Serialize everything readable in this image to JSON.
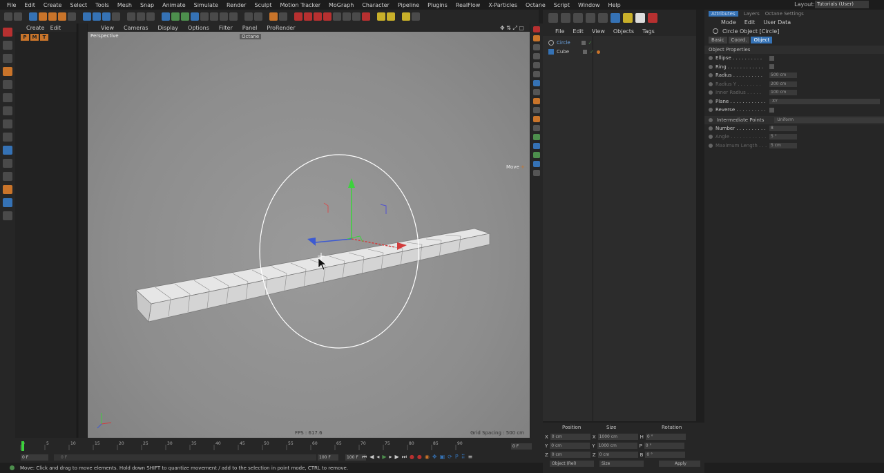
{
  "menubar": {
    "items": [
      "File",
      "Edit",
      "Create",
      "Select",
      "Tools",
      "Mesh",
      "Snap",
      "Animate",
      "Simulate",
      "Render",
      "Sculpt",
      "Motion Tracker",
      "MoGraph",
      "Character",
      "Pipeline",
      "Plugins",
      "RealFlow",
      "X-Particles",
      "Octane",
      "Script",
      "Window",
      "Help"
    ],
    "layout_label": "Layout:",
    "layout_value": "Tutorials (User)"
  },
  "content_browser": {
    "menu": [
      "Create",
      "Edit"
    ],
    "icons": [
      "P",
      "M",
      "T"
    ]
  },
  "viewport": {
    "menu": [
      "View",
      "Cameras",
      "Display",
      "Options",
      "Filter",
      "Panel",
      "ProRender"
    ],
    "name": "Perspective",
    "octane_chip": "Octane",
    "move_label": "Move",
    "fps": "FPS : 617.6",
    "grid_spacing": "Grid Spacing : 500 cm"
  },
  "object_manager": {
    "menu": [
      "File",
      "Edit",
      "View",
      "Objects",
      "Tags"
    ],
    "objects": [
      {
        "name": "Circle",
        "selected": true
      },
      {
        "name": "Cube",
        "selected": false
      }
    ]
  },
  "attributes": {
    "tabs": [
      "Attributes",
      "Layers",
      "Octane Settings"
    ],
    "menu": [
      "Mode",
      "Edit",
      "User Data"
    ],
    "title": "Circle Object [Circle]",
    "buttons": [
      "Basic",
      "Coord.",
      "Object"
    ],
    "section": "Object Properties",
    "props": [
      {
        "label": "Ellipse . . . . . . . . . .",
        "kind": "checkbox",
        "dim": false
      },
      {
        "label": "Ring . . . . . . . . . . . .",
        "kind": "checkbox",
        "dim": false
      },
      {
        "label": "Radius . . . . . . . . . .",
        "kind": "field",
        "value": "500 cm",
        "dim": false
      },
      {
        "label": "Radius Y . . . . . . . .",
        "kind": "field",
        "value": "200 cm",
        "dim": true
      },
      {
        "label": "Inner Radius . . . . .",
        "kind": "field",
        "value": "100 cm",
        "dim": true
      },
      {
        "label": "Plane . . . . . . . . . . . .",
        "kind": "select",
        "value": "XY",
        "dim": false
      },
      {
        "label": "Reverse . . . . . . . . . .",
        "kind": "checkbox",
        "dim": false
      }
    ],
    "intermediate": {
      "label": "Intermediate Points",
      "value": "Uniform"
    },
    "props2": [
      {
        "label": "Number . . . . . . . . . .",
        "kind": "field",
        "value": "8",
        "dim": false
      },
      {
        "label": "Angle . . . . . . . . . . . .",
        "kind": "field",
        "value": "5 °",
        "dim": true
      },
      {
        "label": "Maximum Length . . .",
        "kind": "field",
        "value": "5 cm",
        "dim": true
      }
    ]
  },
  "coordinates": {
    "headers": [
      "Position",
      "Size",
      "Rotation"
    ],
    "rows": [
      {
        "axis": "X",
        "pos": "0 cm",
        "saxis": "X",
        "size": "1000 cm",
        "raxis": "H",
        "rot": "0 °"
      },
      {
        "axis": "Y",
        "pos": "0 cm",
        "saxis": "Y",
        "size": "1000 cm",
        "raxis": "P",
        "rot": "0 °"
      },
      {
        "axis": "Z",
        "pos": "0 cm",
        "saxis": "Z",
        "size": "0 cm",
        "raxis": "B",
        "rot": "0 °"
      }
    ],
    "mode": "Object (Rel)",
    "size_mode": "Size",
    "apply": "Apply"
  },
  "timeline": {
    "ticks": [
      "0",
      "5",
      "10",
      "15",
      "20",
      "25",
      "30",
      "35",
      "40",
      "45",
      "50",
      "55",
      "60",
      "65",
      "70",
      "75",
      "80",
      "85",
      "90"
    ],
    "start": "0 F",
    "current": "0 F",
    "end_a": "100 F",
    "end_b": "100 F",
    "frame_right": "0 F"
  },
  "status": {
    "text": "Move: Click and drag to move elements. Hold down SHIFT to quantize movement / add to the selection in point mode, CTRL to remove."
  }
}
